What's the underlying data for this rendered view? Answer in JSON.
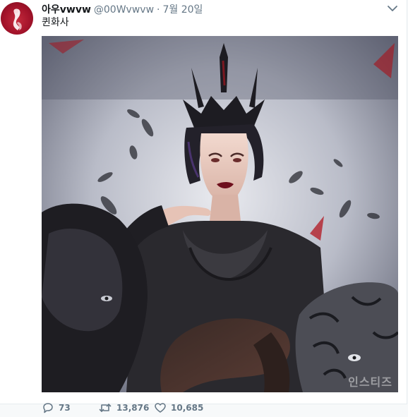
{
  "tweet": {
    "display_name": "아우vwvw",
    "handle": "@00Wvwvw",
    "separator": "·",
    "timestamp": "7월 20일",
    "text": "퀸화사",
    "avatar_icon": "profile-avatar",
    "caret_icon": "chevron-down-icon",
    "media_watermark": "인스티즈",
    "actions": {
      "reply_count": "73",
      "retweet_count": "13,876",
      "like_count": "10,685"
    }
  },
  "colors": {
    "text_primary": "#14171a",
    "text_secondary": "#657786",
    "border": "#e6ecf0",
    "avatar_red": "#a3132a",
    "page_bg": "#f7f9fa"
  }
}
